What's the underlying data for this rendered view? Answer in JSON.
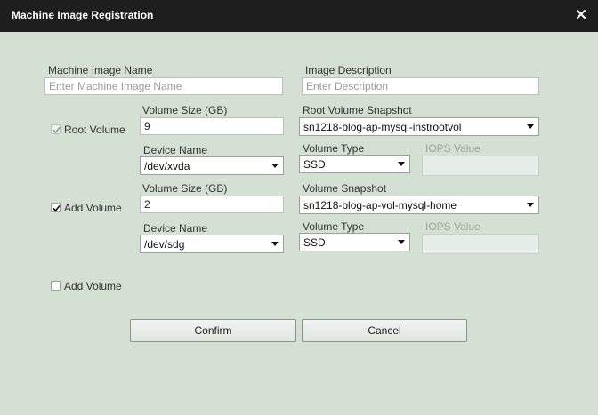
{
  "dialog": {
    "title": "Machine Image Registration",
    "close_icon": "close-icon"
  },
  "form": {
    "image_name": {
      "label": "Machine Image Name",
      "placeholder": "Enter Machine Image Name",
      "value": ""
    },
    "image_description": {
      "label": "Image Description",
      "placeholder": "Enter Description",
      "value": ""
    },
    "root_volume": {
      "checkbox_label": "Root Volume",
      "checked": true,
      "disabled": true,
      "size_label": "Volume Size (GB)",
      "size_value": "9",
      "snapshot_label": "Root Volume Snapshot",
      "snapshot_value": "sn1218-blog-ap-mysql-instrootvol",
      "device_label": "Device Name",
      "device_value": "/dev/xvda",
      "type_label": "Volume Type",
      "type_value": "SSD",
      "iops_label": "IOPS Value",
      "iops_value": ""
    },
    "add_volume_1": {
      "checkbox_label": "Add Volume",
      "checked": true,
      "size_label": "Volume Size (GB)",
      "size_value": "2",
      "snapshot_label": "Volume Snapshot",
      "snapshot_value": "sn1218-blog-ap-vol-mysql-home",
      "device_label": "Device Name",
      "device_value": "/dev/sdg",
      "type_label": "Volume Type",
      "type_value": "SSD",
      "iops_label": "IOPS Value",
      "iops_value": ""
    },
    "add_volume_2": {
      "checkbox_label": "Add Volume",
      "checked": false
    }
  },
  "buttons": {
    "confirm": "Confirm",
    "cancel": "Cancel"
  },
  "colors": {
    "titlebar": "#1e1e1e",
    "background": "#d4e0d4"
  }
}
